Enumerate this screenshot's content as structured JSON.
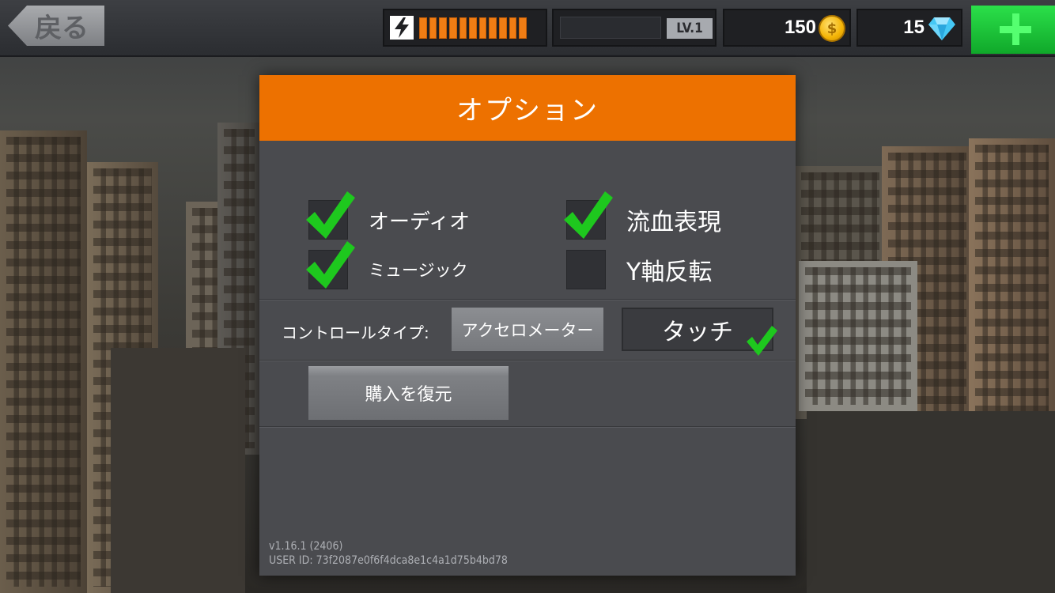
{
  "topbar": {
    "back_label": "戻る",
    "energy": {
      "segments_filled": 11,
      "segments_total": 11
    },
    "level_label": "LV.1",
    "coins": "150",
    "gems": "15"
  },
  "panel": {
    "title": "オプション",
    "options": {
      "audio": {
        "label": "オーディオ",
        "checked": true
      },
      "music": {
        "label": "ミュージック",
        "checked": true
      },
      "blood": {
        "label": "流血表現",
        "checked": true
      },
      "invert_y": {
        "label": "Y軸反転",
        "checked": false
      }
    },
    "control": {
      "label": "コントロールタイプ:",
      "accelerometer": "アクセロメーター",
      "touch": "タッチ",
      "selected": "touch"
    },
    "restore_label": "購入を復元",
    "version": "v1.16.1 (2406)",
    "user_id": "USER ID: 73f2087e0f6f4dca8e1c4a1d75b4bd78"
  },
  "colors": {
    "header_orange": "#ed7100",
    "check_green": "#1ec81e",
    "add_green": "#10a82a",
    "energy_orange": "#f07d14"
  },
  "icons": [
    "back-arrow-icon",
    "lightning-icon",
    "coin-icon",
    "diamond-icon",
    "plus-icon",
    "checkmark-icon"
  ]
}
